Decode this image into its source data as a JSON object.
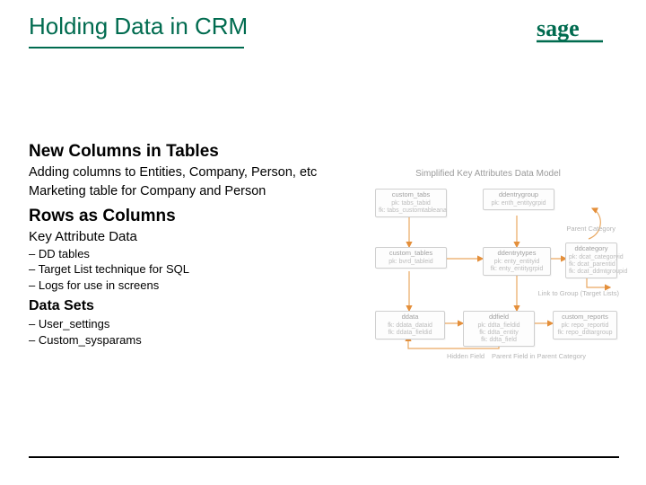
{
  "brand": {
    "name": "sage",
    "color": "#006b4f"
  },
  "title": "Holding Data in CRM",
  "sections": {
    "new_columns": {
      "heading": "New Columns in Tables",
      "line1": "Adding columns to Entities, Company, Person, etc",
      "line2": "Marketing table for Company and Person"
    },
    "rows_as_columns": {
      "heading": "Rows as Columns",
      "sub": "Key Attribute Data",
      "bullets": [
        "DD tables",
        "Target List technique for SQL",
        "Logs for use in screens"
      ]
    },
    "data_sets": {
      "heading": "Data Sets",
      "bullets": [
        "User_settings",
        "Custom_sysparams"
      ]
    }
  },
  "diagram": {
    "title": "Simplified Key Attributes Data Model",
    "boxes": {
      "custom_tabs": {
        "name": "custom_tabs",
        "rows": [
          "pk: tabs_tabid",
          "fk: tabs_customtableana"
        ]
      },
      "ddentrygroup": {
        "name": "ddentrygroup",
        "rows": [
          "pk: enth_entitygrpid"
        ]
      },
      "custom_tables": {
        "name": "custom_tables",
        "rows": [
          "pk: bvrd_tableid"
        ]
      },
      "ddentrytypes": {
        "name": "ddentrytypes",
        "rows": [
          "pk: enty_entityid",
          "fk: enty_entitygrpid"
        ]
      },
      "ddcategory": {
        "name": "ddcategory",
        "rows": [
          "pk: dcat_categoryid",
          "fk: dcat_parentid",
          "fk: dcat_ddmtgroupid"
        ]
      },
      "ddata": {
        "name": "ddata",
        "rows": [
          "fk: ddata_dataid",
          "fk: ddata_fieldid"
        ]
      },
      "ddfield": {
        "name": "ddfield",
        "rows": [
          "pk: ddta_fieldid",
          "fk: ddta_entity",
          "fk: ddta_field"
        ]
      },
      "custom_reports": {
        "name": "custom_reports",
        "rows": [
          "pk: repo_reportid",
          "fk: repo_ddtargroup"
        ]
      }
    },
    "labels": {
      "parent_category": "Parent Category",
      "link_to_group": "Link to Group (Target Lists)",
      "hidden_field": "Hidden Field",
      "parent_field": "Parent Field in Parent Category"
    }
  }
}
